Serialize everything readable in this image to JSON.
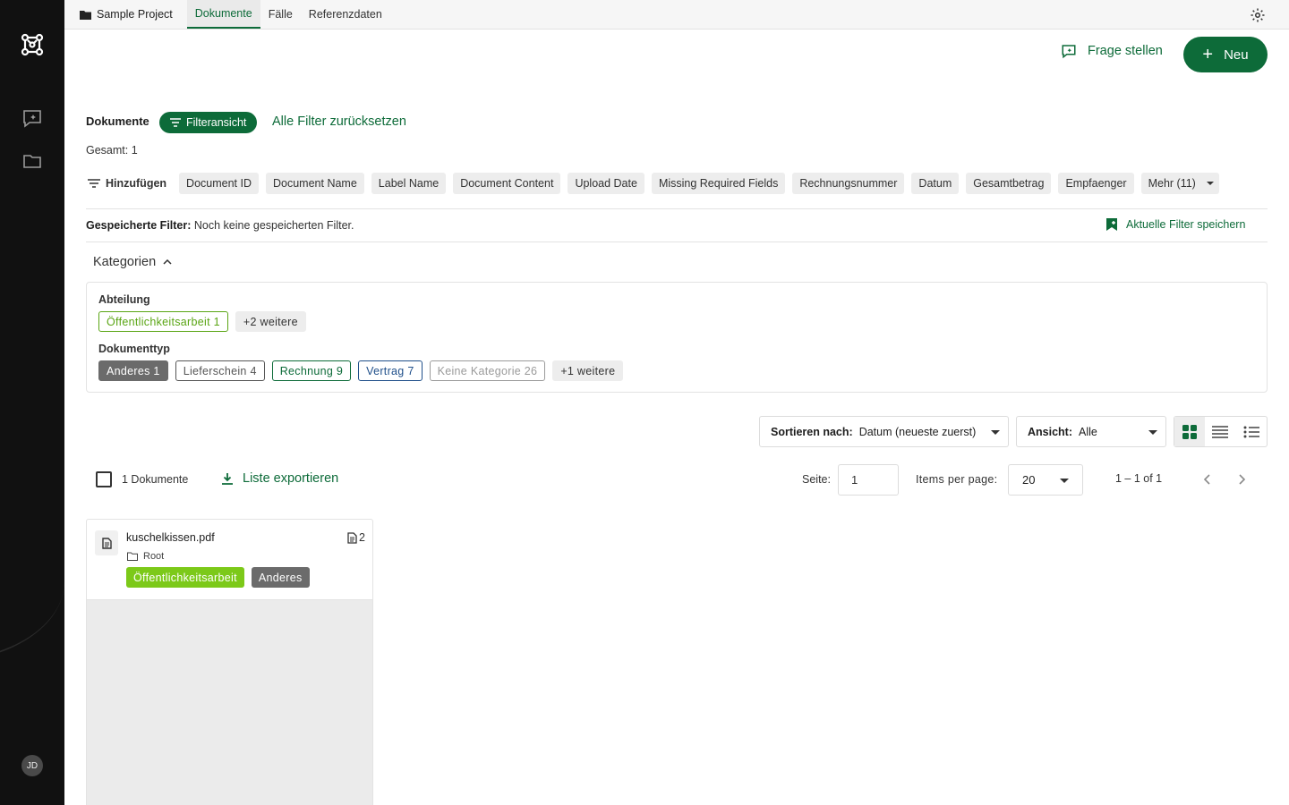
{
  "user": {
    "initials": "JD"
  },
  "topbar": {
    "project": "Sample Project",
    "tabs": [
      {
        "label": "Dokumente",
        "active": true
      },
      {
        "label": "Fälle",
        "active": false
      },
      {
        "label": "Referenzdaten",
        "active": false
      }
    ]
  },
  "header": {
    "ask_label": "Frage stellen",
    "new_label": "Neu"
  },
  "filters": {
    "section_label": "Dokumente",
    "filter_view_label": "Filteransicht",
    "reset_label": "Alle Filter zurücksetzen",
    "total": "Gesamt: 1",
    "add_label": "Hinzufügen",
    "chips": [
      "Document ID",
      "Document Name",
      "Label Name",
      "Document Content",
      "Upload Date",
      "Missing Required Fields",
      "Rechnungsnummer",
      "Datum",
      "Gesamtbetrag",
      "Empfaenger"
    ],
    "more_label": "Mehr (11)",
    "saved_label": "Gespeicherte Filter:",
    "saved_value": "Noch keine gespeicherten Filter.",
    "save_current_label": "Aktuelle Filter speichern"
  },
  "categories": {
    "toggle_label": "Kategorien",
    "groups": [
      {
        "label": "Abteilung",
        "tags": [
          {
            "label": "Öffentlichkeitsarbeit 1",
            "color": "#5aa514"
          }
        ],
        "more": "+2 weitere"
      },
      {
        "label": "Dokumenttyp",
        "tags": [
          {
            "label": "Anderes 1",
            "color": "#6b6b6b",
            "selected": true
          },
          {
            "label": "Lieferschein 4",
            "color": "#555555"
          },
          {
            "label": "Rechnung 9",
            "color": "#0d6b39"
          },
          {
            "label": "Vertrag 7",
            "color": "#1f4f8a"
          },
          {
            "label": "Keine Kategorie 26",
            "color": "#9a9a9a"
          }
        ],
        "more": "+1 weitere"
      }
    ]
  },
  "sort": {
    "label": "Sortieren nach:",
    "value": "Datum (neueste zuerst)"
  },
  "view": {
    "label": "Ansicht:",
    "value": "Alle"
  },
  "list": {
    "count": "1 Dokumente",
    "export_label": "Liste exportieren",
    "page_label": "Seite:",
    "page_value": "1",
    "ipp_label": "Items per page:",
    "ipp_value": "20",
    "range": "1 – 1 of 1"
  },
  "documents": [
    {
      "name": "kuschelkissen.pdf",
      "pages": "2",
      "folder": "Root",
      "badges": [
        {
          "label": "Öffentlichkeitsarbeit",
          "color": "#7cc919"
        },
        {
          "label": "Anderes",
          "color": "#6b6b6b"
        }
      ]
    }
  ],
  "colors": {
    "accent": "#0d6b39",
    "sidebar": "#111111"
  },
  "icons": [
    "app-logo-icon",
    "chat-spark-icon",
    "folder-icon",
    "gear-icon",
    "filter-icon",
    "bookmark-icon",
    "download-icon",
    "grid-view-icon",
    "list-view-icon",
    "detail-list-icon",
    "document-icon",
    "chevron-left-icon",
    "chevron-right-icon",
    "chevron-up-icon"
  ]
}
